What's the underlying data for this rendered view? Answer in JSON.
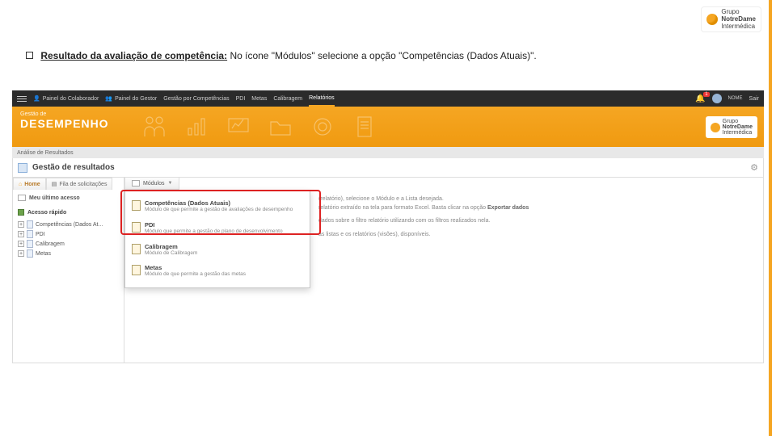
{
  "corner_logo": {
    "line1": "Grupo",
    "line2": "NotreDame",
    "line3": "Intermédica"
  },
  "instruction": {
    "bold": "Resultado da avaliação de competência:",
    "rest": " No ícone \"Módulos\" selecione a opção \"Competências (Dados Atuais)\"."
  },
  "topbar": {
    "items": [
      "Painel do Colaborador",
      "Painel do Gestor",
      "Gestão por Competências",
      "PDI",
      "Metas",
      "Calibragem",
      "Relatórios"
    ],
    "bell_badge": "1",
    "user": "NOME",
    "exit": "Sair"
  },
  "banner": {
    "label": "Gestão de",
    "title": "DESEMPENHO",
    "logo_l1": "Grupo",
    "logo_l2": "NotreDame",
    "logo_l3": "Intermédica"
  },
  "crumb": "Análise de Resultados",
  "page_title": "Gestão de resultados",
  "sidebar": {
    "tab_home": "Home",
    "tab_fila": "Fila de solicitações",
    "last_access": "Meu último acesso",
    "quick": "Acesso rápido",
    "tree": [
      "Competências (Dados At...",
      "PDI",
      "Calibragem",
      "Metas"
    ]
  },
  "modtab": "Módulos",
  "dropdown": [
    {
      "title": "Competências (Dados Atuais)",
      "desc": "Módulo de que permite a gestão de avaliações de desempenho"
    },
    {
      "title": "PDI",
      "desc": "Módulo que permite a gestão de plano de desenvolvimento"
    },
    {
      "title": "Calibragem",
      "desc": "Módulo de Calibragem"
    },
    {
      "title": "Metas",
      "desc": "Módulo de que permite a gestão das metas"
    }
  ],
  "bg": {
    "l1": "(relatório), selecione o Módulo e a Lista desejada.",
    "l2_a": "relatório extraído na tela para formato Excel. Basta clicar na opção ",
    "l2_b": "Exportar dados",
    "l3": "dados sobre o filtro relatório utilizando com os filtros realizados nela.",
    "l4": "as listas e os relatórios (visões), disponíveis."
  }
}
